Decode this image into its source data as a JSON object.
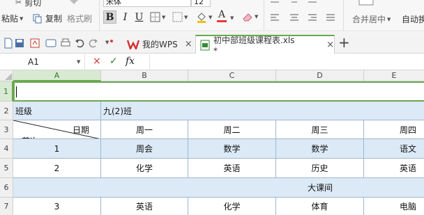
{
  "ribbon": {
    "clipboard": {
      "cut_label": "剪切",
      "paste_label": "粘贴",
      "copy_label": "复制",
      "format_painter_label": "格式刷"
    },
    "font_name": "宋体",
    "font_size": "12",
    "bold": "B",
    "italic": "I",
    "underline": "U",
    "font_color_glyph": "A",
    "merge_center_label": "合并居中",
    "auto_wrap_label": "自动换行"
  },
  "tabs": {
    "app_tab_label": "我的WPS",
    "doc_tab_label": "初中部班级课程表.xls *",
    "new_tab_glyph": "+",
    "close_glyph": "×"
  },
  "formula_bar": {
    "cell_ref": "A1",
    "cancel_glyph": "×",
    "confirm_glyph": "✓",
    "fx_label": "fx",
    "formula_value": ""
  },
  "sheet": {
    "columns": [
      "A",
      "B",
      "C",
      "D",
      "E"
    ],
    "rows": [
      "1",
      "2",
      "3",
      "4",
      "5",
      "6",
      "7"
    ],
    "row2": {
      "label": "班级",
      "value": "九(2)班"
    },
    "row3": {
      "diag_top": "日期",
      "diag_bottom": "节次",
      "days": [
        "周一",
        "周二",
        "周三",
        "周四"
      ]
    },
    "row4": {
      "index": "1",
      "subjects": [
        "周会",
        "数学",
        "数学",
        "语文"
      ]
    },
    "row5": {
      "index": "2",
      "subjects": [
        "化学",
        "英语",
        "历史",
        "英语"
      ]
    },
    "row6": {
      "merged": "大课间"
    },
    "row7": {
      "index": "3",
      "subjects": [
        "英语",
        "化学",
        "体育",
        "电脑"
      ]
    }
  },
  "colors": {
    "selection_green": "#6aa84f",
    "row_fill_blue": "#dce9f6",
    "font_color_red": "#e53935"
  }
}
